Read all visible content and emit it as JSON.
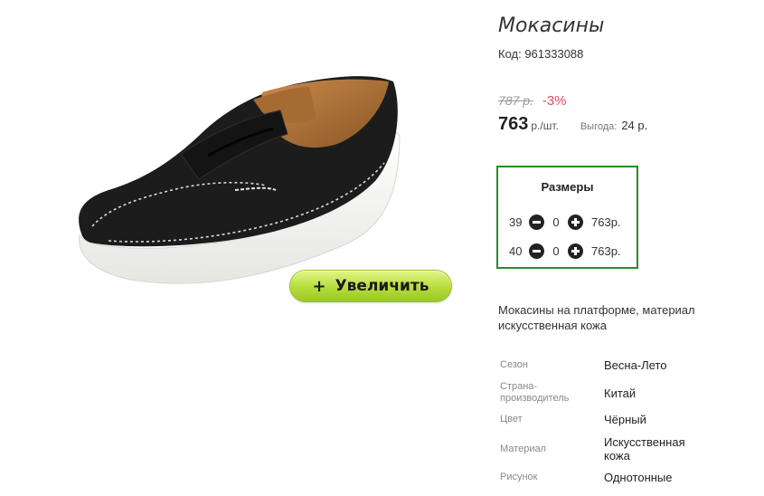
{
  "product": {
    "title": "Мокасины",
    "code": "Код: 961333088",
    "old_price": "787 р.",
    "discount": "-3%",
    "price": "763",
    "price_unit": "р./шт.",
    "savings_label": "Выгода:",
    "savings_value": "24 р.",
    "zoom_button_label": "Увеличить",
    "zoom_button_icon": "plus-icon"
  },
  "sizes": {
    "title": "Размеры",
    "rows": [
      {
        "size": "39",
        "qty": "0",
        "price": "763р."
      },
      {
        "size": "40",
        "qty": "0",
        "price": "763р."
      }
    ],
    "minus_icon": "minus-circle-icon",
    "plus_icon": "plus-circle-icon",
    "border_color": "#2a8a2a"
  },
  "description": "Мокасины на платформе, материал искусственная кожа",
  "attributes": [
    {
      "label": "Сезон",
      "value": "Весна-Лето"
    },
    {
      "label": "Страна-производитель",
      "value": "Китай"
    },
    {
      "label": "Цвет",
      "value": "Чёрный"
    },
    {
      "label": "Материал",
      "value": "Искусственная кожа"
    },
    {
      "label": "Рисунок",
      "value": "Однотонные"
    }
  ],
  "colors": {
    "discount": "#e24a5b",
    "zoom_button": "#b6dc3a",
    "shoe_upper": "#1c1c1c",
    "shoe_sole": "#f4f4f2"
  }
}
